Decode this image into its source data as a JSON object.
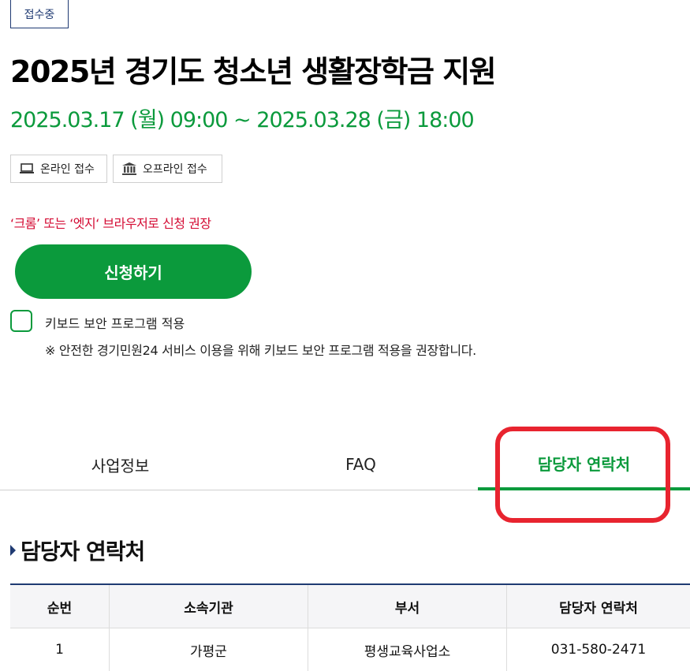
{
  "status_badge": "접수중",
  "title": "2025년 경기도 청소년 생활장학금 지원",
  "period": "2025.03.17 (월) 09:00 ~ 2025.03.28 (금) 18:00",
  "channels": {
    "online": {
      "label": "온라인 접수",
      "icon": "laptop-icon"
    },
    "offline": {
      "label": "오프라인 접수",
      "icon": "building-icon"
    }
  },
  "browser_notice": "‘크롬’ 또는 ‘엣지‘ 브라우저로 신청 권장",
  "apply_button": "신청하기",
  "keyboard_security": {
    "label": "키보드 보안 프로그램 적용",
    "checked": false,
    "note": "※ 안전한 경기민원24 서비스 이용을 위해 키보드 보안 프로그램 적용을 권장합니다."
  },
  "tabs": [
    {
      "label": "사업정보",
      "active": false
    },
    {
      "label": "FAQ",
      "active": false
    },
    {
      "label": "담당자 연락처",
      "active": true
    }
  ],
  "section": {
    "title": "담당자 연락처"
  },
  "table": {
    "headers": [
      "순번",
      "소속기관",
      "부서",
      "담당자 연락처"
    ],
    "rows": [
      [
        "1",
        "가평군",
        "평생교육사업소",
        "031-580-2471"
      ]
    ]
  },
  "colors": {
    "accent_green": "#0b9a3c",
    "navy": "#1f3a72",
    "notice_red": "#d40c34",
    "highlight_red": "#e8242f"
  }
}
